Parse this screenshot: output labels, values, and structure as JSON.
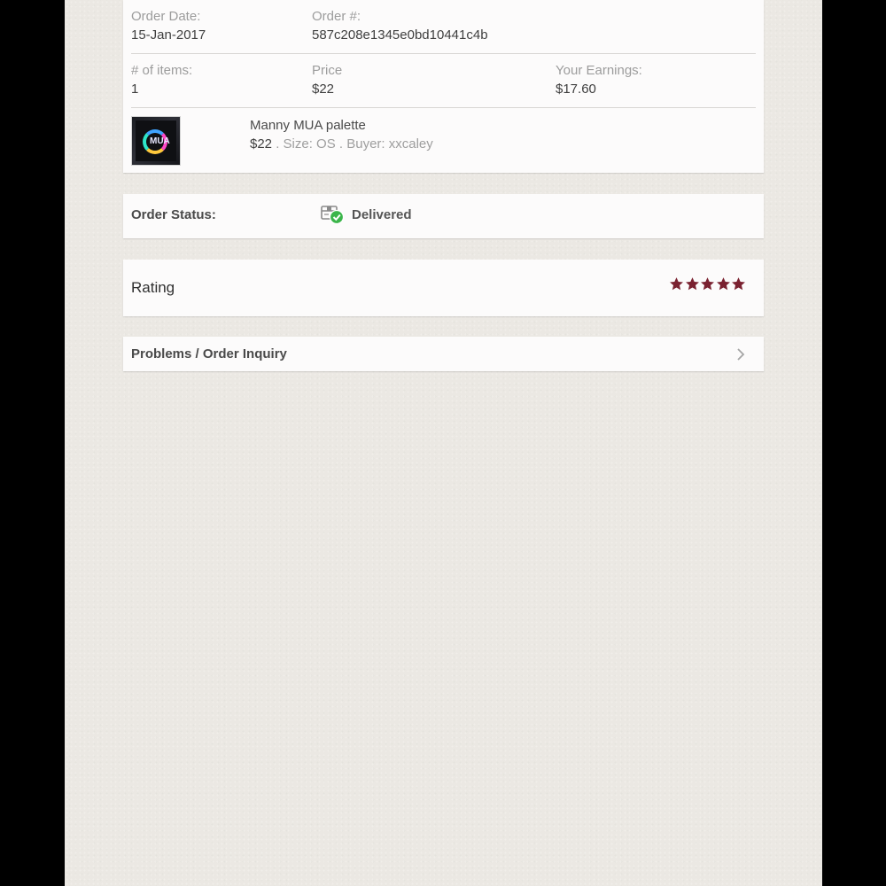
{
  "order": {
    "date_label": "Order Date:",
    "date_value": "15-Jan-2017",
    "number_label": "Order #:",
    "number_value": "587c208e1345e0bd10441c4b",
    "items_label": "# of items:",
    "items_value": "1",
    "price_label": "Price",
    "price_value": "$22",
    "earnings_label": "Your Earnings:",
    "earnings_value": "$17.60"
  },
  "item": {
    "title": "Manny MUA palette",
    "price": "$22",
    "meta": " . Size: OS . Buyer: xxcaley",
    "thumbnail_text": "MUA"
  },
  "status": {
    "label": "Order Status:",
    "value": "Delivered",
    "icon": "package-delivered-icon",
    "icon_color": "#3bb54a"
  },
  "rating": {
    "label": "Rating",
    "stars": 5,
    "max_stars": 5,
    "star_color": "#7a2130"
  },
  "inquiry": {
    "label": "Problems / Order Inquiry",
    "icon": "chevron-right-icon"
  }
}
